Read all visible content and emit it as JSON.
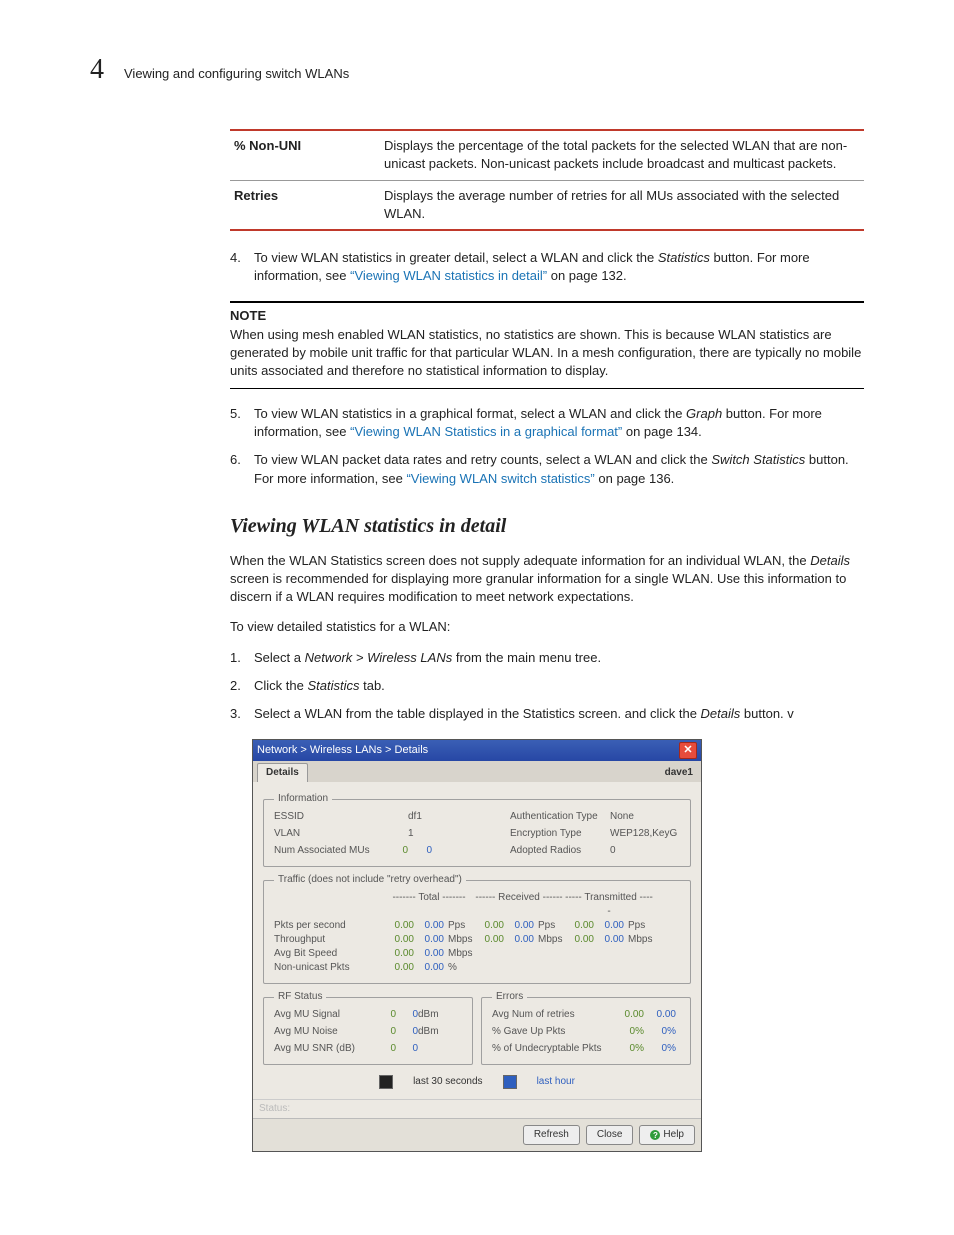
{
  "page": {
    "number": "4",
    "title": "Viewing and configuring switch WLANs"
  },
  "defs": [
    {
      "term": "% Non-UNI",
      "desc": "Displays the percentage of the total packets for the selected WLAN that are non-unicast packets. Non-unicast packets include broadcast and multicast packets."
    },
    {
      "term": "Retries",
      "desc": "Displays the average number of retries for all MUs associated with the selected WLAN."
    }
  ],
  "step4": {
    "num": "4.",
    "pre": "To view WLAN statistics in greater detail, select a WLAN and click the ",
    "btn": "Statistics",
    "post1": " button. For more information, see ",
    "link": "“Viewing WLAN statistics in detail”",
    "post2": " on page 132."
  },
  "note": {
    "label": "NOTE",
    "text": "When using mesh enabled WLAN statistics, no statistics are shown. This is because WLAN statistics are generated by mobile unit traffic for that particular WLAN. In a mesh configuration, there are typically no mobile units associated and therefore no statistical information to display."
  },
  "step5": {
    "num": "5.",
    "pre": "To view WLAN statistics in a graphical format, select a WLAN and click the ",
    "btn": "Graph",
    "post1": " button. For more information, see ",
    "link": "“Viewing WLAN Statistics in a graphical format”",
    "post2": " on page 134."
  },
  "step6": {
    "num": "6.",
    "pre": "To view WLAN packet data rates and retry counts, select a WLAN and click the ",
    "btn": "Switch Statistics",
    "post1": " button. For more information, see ",
    "link": "“Viewing WLAN switch statistics”",
    "post2": " on page 136."
  },
  "subhead": "Viewing WLAN statistics in detail",
  "p1": {
    "a": "When the WLAN Statistics screen does not supply adequate information for an individual WLAN, the ",
    "i": "Details",
    "b": " screen is recommended for displaying more granular information for a single WLAN. Use this information to discern if a WLAN requires modification to meet network expectations."
  },
  "p2": "To view detailed statistics for a WLAN:",
  "s1": {
    "num": "1.",
    "a": "Select a ",
    "i": "Network > Wireless LANs",
    "b": " from the main menu tree."
  },
  "s2": {
    "num": "2.",
    "a": "Click the ",
    "i": "Statistics",
    "b": " tab."
  },
  "s3": {
    "num": "3.",
    "a": "Select a WLAN from the table displayed in the Statistics screen. and click the ",
    "i": "Details",
    "b": " button. v"
  },
  "dialog": {
    "titlebar": "Network > Wireless LANs > Details",
    "tab": "Details",
    "user": "dave1",
    "info": {
      "legend": "Information",
      "essid_l": "ESSID",
      "essid_v": "df1",
      "vlan_l": "VLAN",
      "vlan_v": "1",
      "num_l": "Num Associated MUs",
      "num_v1": "0",
      "num_v2": "0",
      "auth_l": "Authentication Type",
      "auth_v": "None",
      "enc_l": "Encryption Type",
      "enc_v": "WEP128,KeyG",
      "rad_l": "Adopted Radios",
      "rad_v": "0"
    },
    "traffic": {
      "legend": "Traffic (does not include \"retry overhead\")",
      "h_total": "------- Total -------",
      "h_recv": "------ Received ------",
      "h_tx": "----- Transmitted -----",
      "rows": [
        {
          "l": "Pkts per second",
          "t1": "0.00",
          "t2": "0.00",
          "tu": "Pps",
          "r1": "0.00",
          "r2": "0.00",
          "ru": "Pps",
          "x1": "0.00",
          "x2": "0.00",
          "xu": "Pps"
        },
        {
          "l": "Throughput",
          "t1": "0.00",
          "t2": "0.00",
          "tu": "Mbps",
          "r1": "0.00",
          "r2": "0.00",
          "ru": "Mbps",
          "x1": "0.00",
          "x2": "0.00",
          "xu": "Mbps"
        },
        {
          "l": "Avg Bit Speed",
          "t1": "0.00",
          "t2": "0.00",
          "tu": "Mbps"
        },
        {
          "l": "Non-unicast Pkts",
          "t1": "0.00",
          "t2": "0.00",
          "tu": "%"
        }
      ]
    },
    "rf": {
      "legend": "RF Status",
      "rows": [
        {
          "l": "Avg MU Signal",
          "v1": "0",
          "v2": "0",
          "u": "dBm"
        },
        {
          "l": "Avg MU Noise",
          "v1": "0",
          "v2": "0",
          "u": "dBm"
        },
        {
          "l": "Avg MU SNR (dB)",
          "v1": "0",
          "v2": "0",
          "u": ""
        }
      ]
    },
    "err": {
      "legend": "Errors",
      "rows": [
        {
          "l": "Avg Num of retries",
          "v1": "0.00",
          "v2": "0.00"
        },
        {
          "l": "% Gave Up Pkts",
          "v1": "0%",
          "v2": "0%"
        },
        {
          "l": "% of Undecryptable Pkts",
          "v1": "0%",
          "v2": "0%"
        }
      ]
    },
    "legend_row": {
      "a": "last 30 seconds",
      "b": "last hour"
    },
    "status": "Status:",
    "buttons": {
      "refresh": "Refresh",
      "close": "Close",
      "help": "Help"
    }
  }
}
